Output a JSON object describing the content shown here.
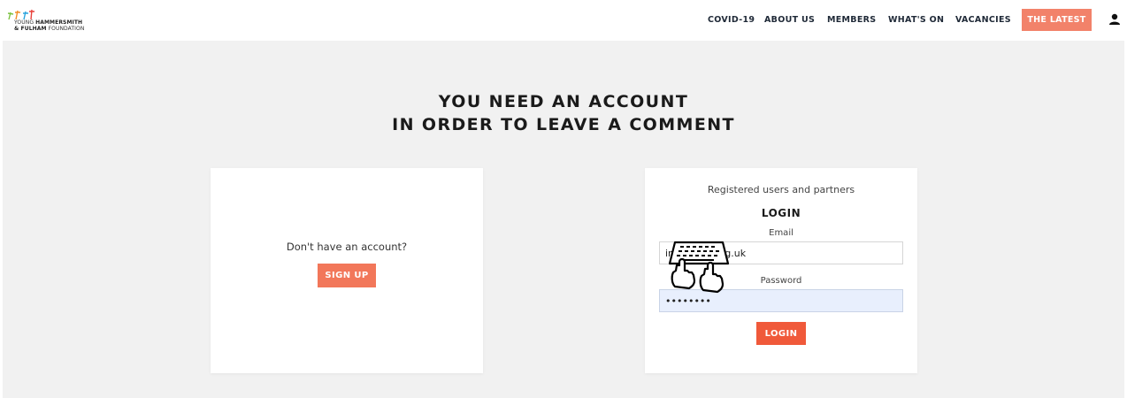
{
  "header": {
    "logo": {
      "line1_light": "YOUNG",
      "line1_bold": "HAMMERSMITH",
      "line2_bold": "& FULHAM",
      "line2_light": "FOUNDATION"
    },
    "nav": [
      "COVID-19",
      "ABOUT US",
      "MEMBERS",
      "WHAT'S ON",
      "VACANCIES"
    ],
    "cta": "THE LATEST",
    "user_icon": "user-icon"
  },
  "main": {
    "heading_line1": "YOU NEED AN ACCOUNT",
    "heading_line2": "IN ORDER TO LEAVE A COMMENT",
    "signup_card": {
      "prompt": "Don't have an account?",
      "button": "SIGN UP"
    },
    "login_card": {
      "subtitle": "Registered users and partners",
      "title": "LOGIN",
      "email_label": "Email",
      "email_value": "info@yhff.org.uk",
      "password_label": "Password",
      "password_value": "••••••••",
      "button": "LOGIN"
    },
    "overlay_icon": "keyboard-typing-icon"
  },
  "colors": {
    "accent": "#f0593a",
    "accent_light": "#f2826a",
    "page_bg": "#f1f1f1",
    "autofill": "#e8effd"
  }
}
